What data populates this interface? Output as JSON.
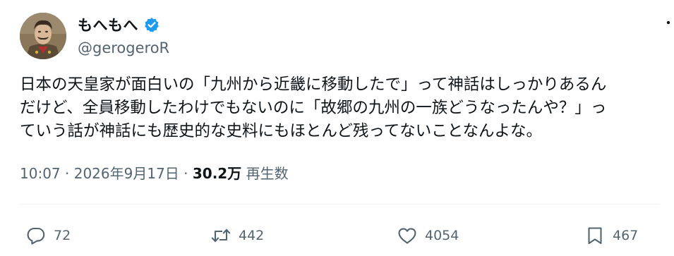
{
  "author": {
    "display_name": "もへもへ",
    "handle": "@gerogeroR",
    "verified": true
  },
  "tweet": {
    "lines": [
      "日本の天皇家が面白いの「九州から近畿に移動したで」って神話はしっかりあるん",
      "だけど、全員移動したわけでもないのに「故郷の九州の一族どうなったんや？」っ",
      "ていう話が神話にも歴史的な史料にもほとんど残ってないことなんよな。"
    ],
    "time": "10:07",
    "separator": "·",
    "date": "2026年9月17日",
    "views_count": "30.2万",
    "views_label": "再生数"
  },
  "actions": {
    "replies": "72",
    "retweets": "442",
    "likes": "4054",
    "bookmarks": "467"
  },
  "colors": {
    "text": "#0f1419",
    "secondary": "#536471",
    "verified_badge": "#1d9bf0"
  }
}
